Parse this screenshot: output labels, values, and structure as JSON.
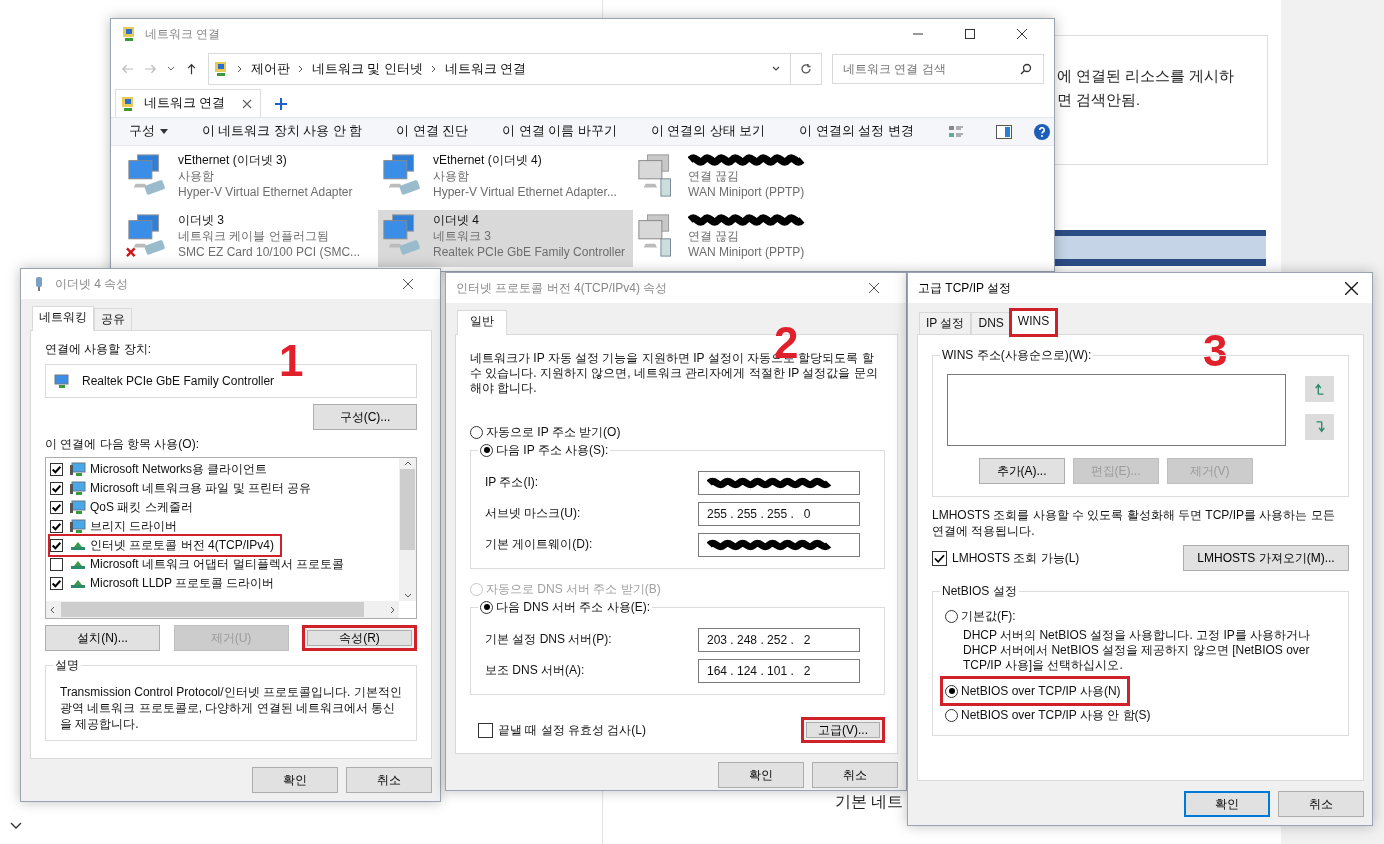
{
  "background": {
    "notice_lines": [
      "에 연결된 리소스를 게시하",
      "면 검색안됨."
    ],
    "heading_fragment": "기본 네트"
  },
  "explorer": {
    "title": "네트워크 연결",
    "active": false,
    "breadcrumb": [
      "제어판",
      "네트워크 및 인터넷",
      "네트워크 연결"
    ],
    "search_placeholder": "네트워크 연결 검색",
    "tab": "네트워크 연결",
    "toolbar": [
      {
        "label": "구성",
        "menu": true
      },
      {
        "label": "이 네트워크 장치 사용 안 함",
        "menu": false
      },
      {
        "label": "이 연결 진단",
        "menu": false
      },
      {
        "label": "이 연결 이름 바꾸기",
        "menu": false
      },
      {
        "label": "이 연결의 상태 보기",
        "menu": false
      },
      {
        "label": "이 연결의 설정 변경",
        "menu": false
      }
    ],
    "connections": [
      {
        "name": "vEthernet (이더넷 3)",
        "status": "사용함",
        "adapter": "Hyper-V Virtual Ethernet Adapter",
        "kind": "ethernet",
        "unplugged": false,
        "selected": false
      },
      {
        "name": "vEthernet (이더넷 4)",
        "status": "사용함",
        "adapter": "Hyper-V Virtual Ethernet Adapter...",
        "kind": "ethernet",
        "unplugged": false,
        "selected": false
      },
      {
        "status": "연결 끊김",
        "adapter": "WAN Miniport (PPTP)",
        "kind": "wan",
        "unplugged": false,
        "selected": false
      },
      {
        "name": "이더넷 3",
        "status": "네트워크 케이블 언플러그됨",
        "adapter": "SMC EZ Card 10/100 PCI (SMC...",
        "kind": "ethernet",
        "unplugged": true,
        "selected": false
      },
      {
        "name": "이더넷 4",
        "status": "네트워크 3",
        "adapter": "Realtek PCIe GbE Family Controller",
        "kind": "ethernet",
        "unplugged": false,
        "selected": true
      },
      {
        "status": "연결 끊김",
        "adapter": "WAN Miniport (PPTP)",
        "kind": "wan",
        "unplugged": false,
        "selected": false
      }
    ]
  },
  "dialog1": {
    "title": "이더넷 4 속성",
    "active": false,
    "step": "1",
    "tabs": [
      {
        "label": "네트워킹",
        "selected": true
      },
      {
        "label": "공유",
        "selected": false
      }
    ],
    "device_label": "연결에 사용할 장치:",
    "device": "Realtek PCIe GbE Family Controller",
    "configure_button": "구성(C)...",
    "items_label": "이 연결에 다음 항목 사용(O):",
    "items": [
      {
        "label": "Microsoft Networks용 클라이언트",
        "checked": true,
        "kind": "service",
        "highlighted": false
      },
      {
        "label": "Microsoft 네트워크용 파일 및 프린터 공유",
        "checked": true,
        "kind": "service",
        "highlighted": false
      },
      {
        "label": "QoS 패킷 스케줄러",
        "checked": true,
        "kind": "service",
        "highlighted": false
      },
      {
        "label": "브리지 드라이버",
        "checked": true,
        "kind": "service",
        "highlighted": false
      },
      {
        "label": "인터넷 프로토콜 버전 4(TCP/IPv4)",
        "checked": true,
        "kind": "protocol",
        "highlighted": true
      },
      {
        "label": "Microsoft 네트워크 어댑터 멀티플렉서 프로토콜",
        "checked": false,
        "kind": "protocol",
        "highlighted": false
      },
      {
        "label": "Microsoft LLDP 프로토콜 드라이버",
        "checked": true,
        "kind": "protocol",
        "highlighted": false
      }
    ],
    "buttons": [
      {
        "label": "설치(N)...",
        "disabled": false,
        "highlighted": false
      },
      {
        "label": "제거(U)",
        "disabled": true,
        "highlighted": false
      },
      {
        "label": "속성(R)",
        "disabled": false,
        "highlighted": true
      }
    ],
    "description_title": "설명",
    "description": "Transmission Control Protocol/인터넷 프로토콜입니다. 기본적인 광역 네트워크 프로토콜로, 다양하게 연결된 네트워크에서 통신을 제공합니다.",
    "footer": [
      {
        "label": "확인",
        "default": false
      },
      {
        "label": "취소",
        "default": false
      }
    ]
  },
  "dialog2": {
    "title": "인터넷 프로토콜 버전 4(TCP/IPv4) 속성",
    "active": false,
    "step": "2",
    "tabs": [
      {
        "label": "일반",
        "selected": true
      }
    ],
    "intro": "네트워크가 IP 자동 설정 기능을 지원하면 IP 설정이 자동으로 할당되도록 할 수 있습니다. 지원하지 않으면, 네트워크 관리자에게 적절한 IP 설정값을 문의해야 합니다.",
    "ip_options": [
      {
        "label": "자동으로 IP 주소 받기(O)",
        "selected": false,
        "disabled": false
      },
      {
        "label": "다음 IP 주소 사용(S):",
        "selected": true,
        "disabled": false
      }
    ],
    "ip_fields": [
      {
        "label": "IP 주소(I):"
      },
      {
        "label": "서브넷 마스크(U):",
        "value": "255 . 255 . 255 .   0"
      },
      {
        "label": "기본 게이트웨이(D):"
      }
    ],
    "dns_options": [
      {
        "label": "자동으로 DNS 서버 주소 받기(B)",
        "selected": false,
        "disabled": true
      },
      {
        "label": "다음 DNS 서버 주소 사용(E):",
        "selected": true,
        "disabled": false
      }
    ],
    "dns_fields": [
      {
        "label": "기본 설정 DNS 서버(P):",
        "value": "203 . 248 . 252 .   2"
      },
      {
        "label": "보조 DNS 서버(A):",
        "value": "164 . 124 . 101 .   2"
      }
    ],
    "validate": {
      "label": "끝낼 때 설정 유효성 검사(L)",
      "checked": false
    },
    "advanced_button": {
      "label": "고급(V)...",
      "highlighted": true
    },
    "footer": [
      {
        "label": "확인",
        "default": false
      },
      {
        "label": "취소",
        "default": false
      }
    ]
  },
  "dialog3": {
    "title": "고급 TCP/IP 설정",
    "active": true,
    "step": "3",
    "tabs": [
      {
        "label": "IP 설정",
        "selected": false,
        "highlighted": false
      },
      {
        "label": "DNS",
        "selected": false,
        "highlighted": false
      },
      {
        "label": "WINS",
        "selected": true,
        "highlighted": true
      }
    ],
    "wins_group": "WINS 주소(사용순으로)(W):",
    "wins_buttons": [
      {
        "label": "추가(A)...",
        "disabled": false
      },
      {
        "label": "편집(E)...",
        "disabled": true
      },
      {
        "label": "제거(V)",
        "disabled": true
      }
    ],
    "lmhosts_text": "LMHOSTS 조회를 사용할 수 있도록 활성화해 두면 TCP/IP를 사용하는 모든 연결에 적용됩니다.",
    "lmhosts_check": {
      "label": "LMHOSTS 조회 가능(L)",
      "checked": true
    },
    "lmhosts_button": "LMHOSTS 가져오기(M)...",
    "netbios_group": "NetBIOS 설정",
    "netbios_options": [
      {
        "label": "기본값(F):",
        "selected": false,
        "highlighted": false,
        "description": "DHCP 서버의 NetBIOS 설정을 사용합니다. 고정 IP를 사용하거나 DHCP 서버에서 NetBIOS 설정을 제공하지 않으면 [NetBIOS over TCP/IP 사용]을 선택하십시오."
      },
      {
        "label": "NetBIOS over TCP/IP 사용(N)",
        "selected": true,
        "highlighted": true
      },
      {
        "label": "NetBIOS over TCP/IP 사용 안 함(S)",
        "selected": false,
        "highlighted": false
      }
    ],
    "footer": [
      {
        "label": "확인",
        "default": true
      },
      {
        "label": "취소",
        "default": false
      }
    ]
  }
}
